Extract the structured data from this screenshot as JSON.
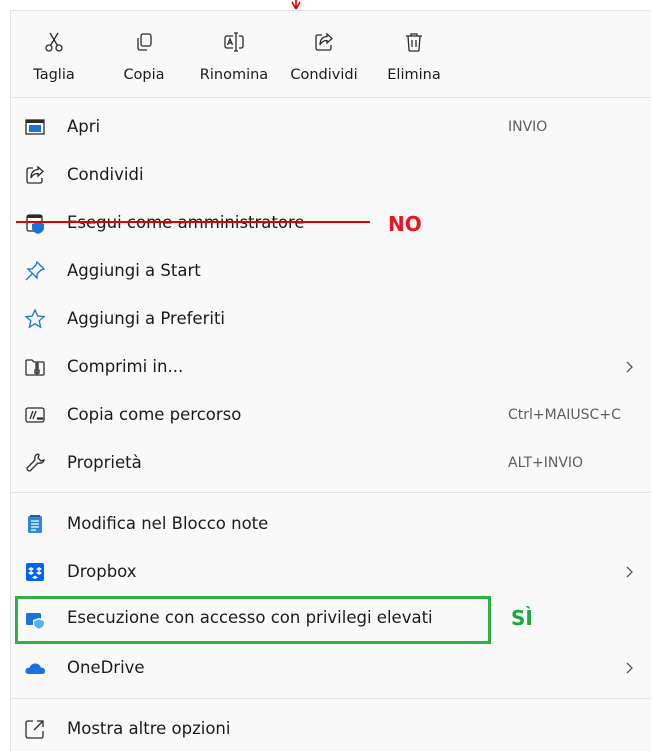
{
  "toolbar": [
    {
      "label": "Taglia",
      "icon": "scissors-icon"
    },
    {
      "label": "Copia",
      "icon": "copy-icon"
    },
    {
      "label": "Rinomina",
      "icon": "rename-icon"
    },
    {
      "label": "Condividi",
      "icon": "share-icon"
    },
    {
      "label": "Elimina",
      "icon": "trash-icon"
    }
  ],
  "menu": {
    "apri": {
      "label": "Apri",
      "shortcut": "INVIO",
      "icon": "window-icon"
    },
    "condividi": {
      "label": "Condividi",
      "icon": "share-icon"
    },
    "esegui_admin": {
      "label": "Esegui come amministratore",
      "icon": "shield-icon"
    },
    "aggiungi_start": {
      "label": "Aggiungi a Start",
      "icon": "pin-icon"
    },
    "aggiungi_preferiti": {
      "label": "Aggiungi a Preferiti",
      "icon": "star-icon"
    },
    "comprimi": {
      "label": "Comprimi in...",
      "icon": "zip-folder-icon"
    },
    "copia_percorso": {
      "label": "Copia come percorso",
      "shortcut": "Ctrl+MAIUSC+C",
      "icon": "path-icon"
    },
    "proprieta": {
      "label": "Proprietà",
      "shortcut": "ALT+INVIO",
      "icon": "wrench-icon"
    },
    "blocco_note": {
      "label": "Modifica nel Blocco note",
      "icon": "notepad-icon"
    },
    "dropbox": {
      "label": "Dropbox",
      "icon": "dropbox-icon"
    },
    "elevated": {
      "label": "Esecuzione con accesso con privilegi elevati",
      "icon": "elevated-run-icon"
    },
    "onedrive": {
      "label": "OneDrive",
      "icon": "cloud-icon"
    },
    "altre_opzioni": {
      "label": "Mostra altre opzioni",
      "icon": "more-options-icon"
    }
  },
  "annotations": {
    "no": "NO",
    "si": "SÌ"
  },
  "colors": {
    "annotation_red": "#e8141e",
    "annotation_green": "#31b043",
    "menu_background": "#f9f9fa",
    "accent_blue": "#1a73d9"
  }
}
